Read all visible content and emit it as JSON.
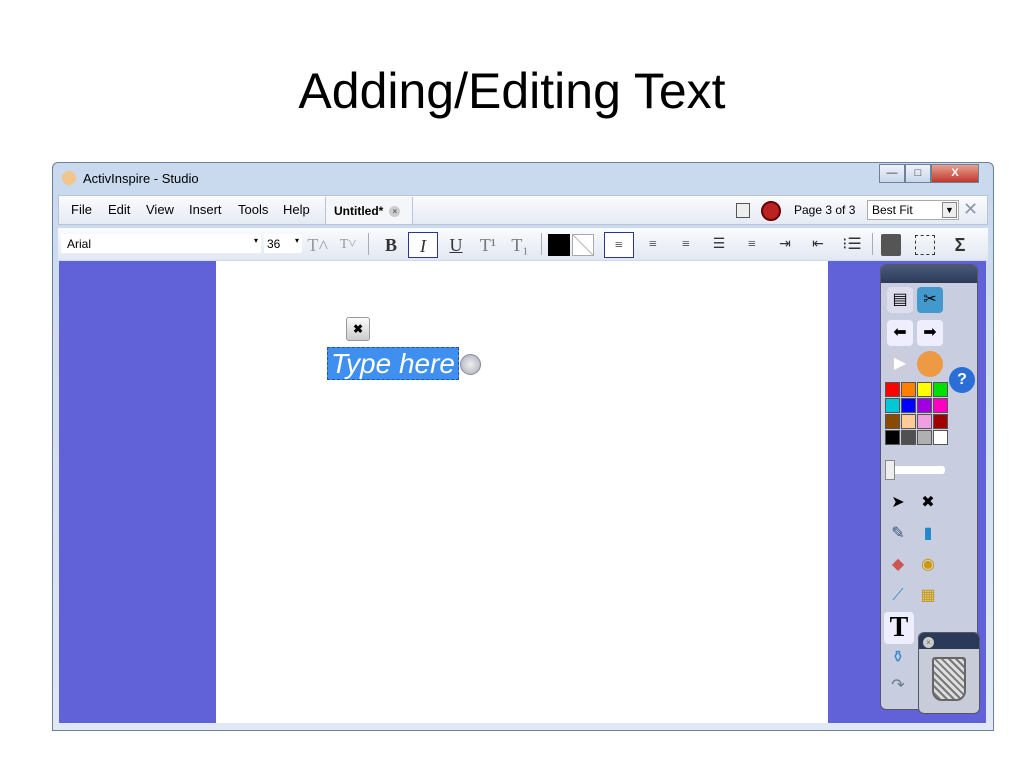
{
  "slide": {
    "title": "Adding/Editing Text"
  },
  "window": {
    "title": "ActivInspire - Studio",
    "min": "—",
    "max": "□",
    "close": "X"
  },
  "menu": [
    "File",
    "Edit",
    "View",
    "Insert",
    "Tools",
    "Help"
  ],
  "tab": {
    "label": "Untitled*",
    "close": "×"
  },
  "page_info": "Page 3 of 3",
  "zoom": {
    "value": "Best Fit",
    "arrow": "▼"
  },
  "format": {
    "font": "Arial",
    "size": "36",
    "bold": "B",
    "italic": "I",
    "underline": "U",
    "grow": "T˄",
    "shrink": "T˅",
    "superscript": "T¹",
    "subscript": "T₁",
    "sigma": "Σ",
    "arrow": "▾"
  },
  "canvas": {
    "text": "Type here",
    "move": "✖"
  },
  "palette": [
    "#ff0000",
    "#ff8000",
    "#ffff00",
    "#00e000",
    "#00c8d8",
    "#0000ff",
    "#a000e0",
    "#ff00c0",
    "#8a4a00",
    "#ffcc99",
    "#f0a0e0",
    "#a00000",
    "#000000",
    "#505050",
    "#b0b0b0",
    "#ffffff"
  ],
  "toolbox": {
    "text_tool": "T",
    "help": "?"
  }
}
